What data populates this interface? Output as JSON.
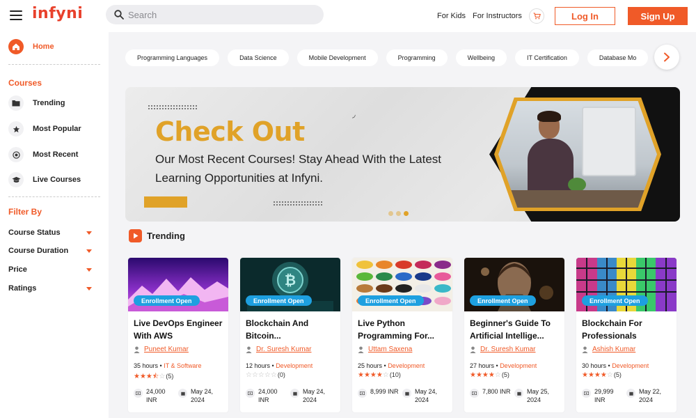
{
  "header": {
    "logo": "infyni",
    "search_placeholder": "Search",
    "links": [
      "For Kids",
      "For Instructors"
    ],
    "login_label": "Log In",
    "signup_label": "Sign Up"
  },
  "sidebar": {
    "home_label": "Home",
    "courses_heading": "Courses",
    "course_items": [
      {
        "label": "Trending",
        "icon": "folder-icon"
      },
      {
        "label": "Most Popular",
        "icon": "star-icon"
      },
      {
        "label": "Most Recent",
        "icon": "target-icon"
      },
      {
        "label": "Live Courses",
        "icon": "graduation-cap-icon"
      }
    ],
    "filter_heading": "Filter By",
    "filters": [
      "Course Status",
      "Course Duration",
      "Price",
      "Ratings"
    ]
  },
  "categories": [
    "Programming Languages",
    "Data Science",
    "Mobile Development",
    "Programming",
    "Wellbeing",
    "IT Certification",
    "Database Mo"
  ],
  "banner": {
    "title": "Check Out",
    "subtitle": "Our Most Recent Courses! Stay Ahead With the Latest Learning Opportunities at Infyni.",
    "active_slide": 3,
    "slide_count": 3
  },
  "trending": {
    "heading": "Trending",
    "courses": [
      {
        "badge": "Enrollment Open",
        "title": "Live DevOps Engineer With AWS",
        "author": "Puneet Kumar",
        "hours": "35 hours",
        "category": "IT & Software",
        "rating": 3.5,
        "reviews": "(5)",
        "price": "24,000 INR",
        "date": "May 24, 2024"
      },
      {
        "badge": "Enrollment Open",
        "title": "Blockchain And Bitcoin...",
        "author": "Dr. Suresh Kumar",
        "hours": "12 hours",
        "category": "Development",
        "rating": 0,
        "reviews": "(0)",
        "price": "24,000 INR",
        "date": "May 24, 2024"
      },
      {
        "badge": "Enrollment Open",
        "title": "Live Python Programming For...",
        "author": "Uttam Saxena",
        "hours": "25 hours",
        "category": "Development",
        "rating": 4,
        "reviews": "(10)",
        "price": "8,999 INR",
        "date": "May 24, 2024"
      },
      {
        "badge": "Enrollment Open",
        "title": "Beginner's Guide To Artificial Intellige...",
        "author": "Dr. Suresh Kumar",
        "hours": "27 hours",
        "category": "Development",
        "rating": 4,
        "reviews": "(5)",
        "price": "7,800 INR",
        "date": "May 25, 2024"
      },
      {
        "badge": "Enrollment Open",
        "title": "Blockchain For Professionals",
        "author": "Ashish Kumar",
        "hours": "30 hours",
        "category": "Development",
        "rating": 4,
        "reviews": "(5)",
        "price": "29,999 INR",
        "date": "May 22, 2024"
      }
    ]
  },
  "colors": {
    "brand": "#f05a28",
    "logo": "#e8412c",
    "banner_accent": "#e0a228",
    "badge": "#1ea0e0"
  }
}
